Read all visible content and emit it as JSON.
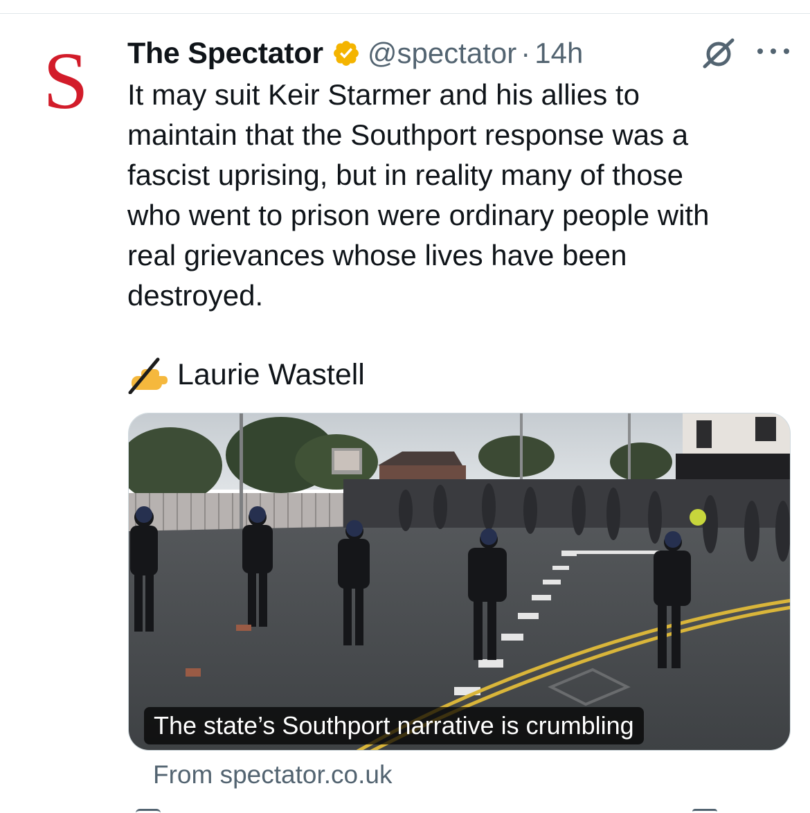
{
  "tweet": {
    "author": {
      "display_name": "The Spectator",
      "logo_letter": "S",
      "verified": true,
      "verified_color": "#f4b400",
      "handle": "@spectator",
      "separator": "·",
      "time": "14h"
    },
    "text_lines": [
      "It may suit Keir Starmer and his allies to",
      "maintain that the Southport response was a",
      "fascist uprising, but in reality many of those",
      "who went to prison were ordinary people with",
      "real grievances whose lives have been",
      "destroyed."
    ],
    "author_credit": "Laurie Wastell",
    "author_credit_icon": "writing-hand-emoji",
    "card": {
      "image_subject": "riot-police-line-facing-crowd-on-street",
      "title": "The state’s Southport narrative is crumbling",
      "source": "From spectator.co.uk"
    },
    "icons": [
      "grok-icon",
      "more-icon"
    ]
  },
  "colors": {
    "text_primary": "#0f1419",
    "text_secondary": "#536471",
    "logo_red": "#d21c2a",
    "divider": "#e1e6ea"
  }
}
